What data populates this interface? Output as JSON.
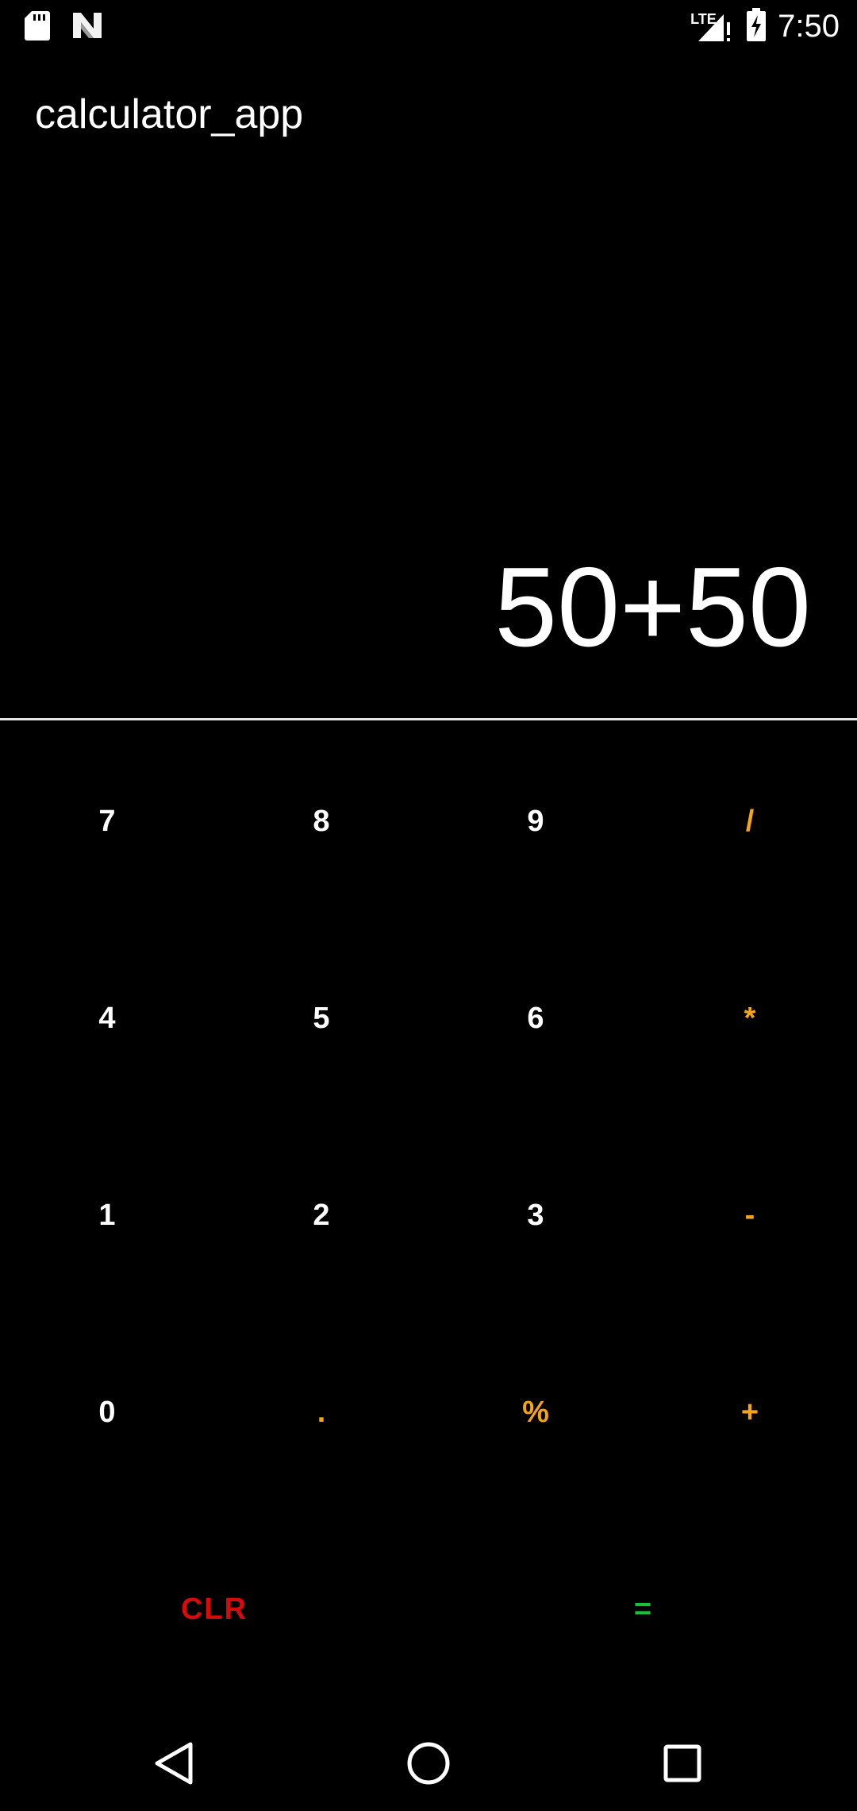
{
  "status_bar": {
    "left_icons": [
      "sd-card-icon",
      "n-logo-icon"
    ],
    "network_label": "LTE",
    "time": "7:50",
    "right_icons": [
      "signal-icon",
      "battery-charging-icon"
    ]
  },
  "app": {
    "title": "calculator_app"
  },
  "display": {
    "expression": "50+50"
  },
  "keypad": {
    "rows": [
      [
        {
          "label": "7",
          "type": "digit"
        },
        {
          "label": "8",
          "type": "digit"
        },
        {
          "label": "9",
          "type": "digit"
        },
        {
          "label": "/",
          "type": "op"
        }
      ],
      [
        {
          "label": "4",
          "type": "digit"
        },
        {
          "label": "5",
          "type": "digit"
        },
        {
          "label": "6",
          "type": "digit"
        },
        {
          "label": "*",
          "type": "op"
        }
      ],
      [
        {
          "label": "1",
          "type": "digit"
        },
        {
          "label": "2",
          "type": "digit"
        },
        {
          "label": "3",
          "type": "digit"
        },
        {
          "label": "-",
          "type": "op"
        }
      ],
      [
        {
          "label": "0",
          "type": "digit"
        },
        {
          "label": ".",
          "type": "op"
        },
        {
          "label": "%",
          "type": "op"
        },
        {
          "label": "+",
          "type": "op"
        }
      ],
      [
        {
          "label": "CLR",
          "type": "clr"
        },
        {
          "label": "=",
          "type": "eq"
        }
      ]
    ]
  },
  "colors": {
    "background": "#000000",
    "digit": "#ffffff",
    "operator": "#f5a515",
    "clear": "#d60b0b",
    "equals": "#19c13a",
    "divider": "#e6e6e6"
  },
  "nav_bar": {
    "icons": [
      "back-icon",
      "home-icon",
      "recents-icon"
    ]
  }
}
